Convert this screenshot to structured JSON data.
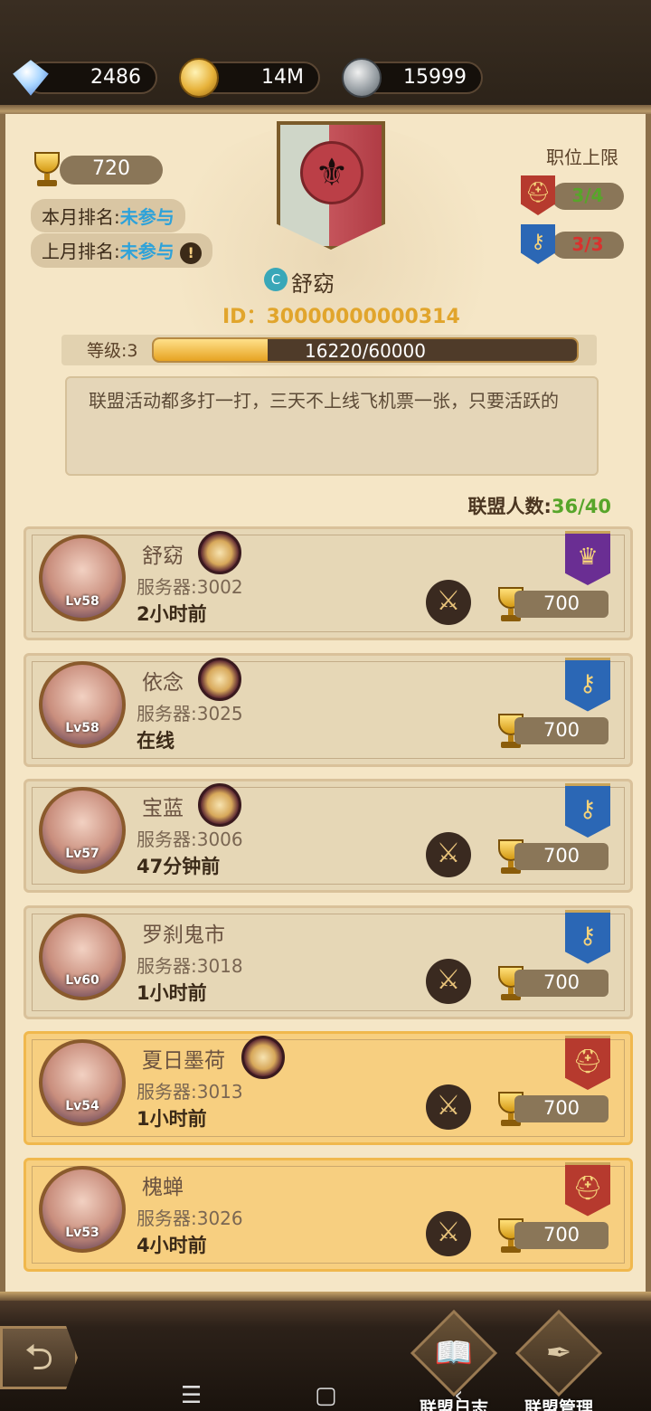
{
  "resources": {
    "diamonds": "2486",
    "gold": "14M",
    "silver": "15999"
  },
  "guild": {
    "trophy_points": "720",
    "this_month_label": "本月排名:",
    "this_month_value": "未参与",
    "last_month_label": "上月排名:",
    "last_month_value": "未参与",
    "position_limit_label": "职位上限",
    "slot_red": "3/4",
    "slot_blue": "3/3",
    "name_badge": "C",
    "name": "舒窈",
    "id_text": "ID：30000000000314",
    "level_label": "等级:3",
    "exp_text": "16220/60000",
    "exp_progress": 0.27,
    "notice": "联盟活动都多打一打，三天不上线飞机票一张，只要活跃的",
    "member_count_label": "联盟人数:",
    "member_count_value": "36/40"
  },
  "members": [
    {
      "name": "舒窈",
      "level": "Lv58",
      "server": "服务器:3002",
      "status": "2小时前",
      "score": "700",
      "role": "purple",
      "role_icon": "crown-icon",
      "badge": true,
      "swords": true,
      "highlight": false
    },
    {
      "name": "依念",
      "level": "Lv58",
      "server": "服务器:3025",
      "status": "在线",
      "score": "700",
      "role": "blue",
      "role_icon": "key-icon",
      "badge": true,
      "swords": false,
      "highlight": false
    },
    {
      "name": "宝蓝",
      "level": "Lv57",
      "server": "服务器:3006",
      "status": "47分钟前",
      "score": "700",
      "role": "blue",
      "role_icon": "key-icon",
      "badge": true,
      "swords": true,
      "highlight": false
    },
    {
      "name": "罗刹鬼市",
      "level": "Lv60",
      "server": "服务器:3018",
      "status": "1小时前",
      "score": "700",
      "role": "blue",
      "role_icon": "key-icon",
      "badge": false,
      "swords": true,
      "highlight": false
    },
    {
      "name": "夏日墨荷",
      "level": "Lv54",
      "server": "服务器:3013",
      "status": "1小时前",
      "score": "700",
      "role": "red",
      "role_icon": "helmet-icon",
      "badge": true,
      "swords": true,
      "highlight": true
    },
    {
      "name": "槐蝉",
      "level": "Lv53",
      "server": "服务器:3026",
      "status": "4小时前",
      "score": "700",
      "role": "red",
      "role_icon": "helmet-icon",
      "badge": false,
      "swords": true,
      "highlight": true
    }
  ],
  "bottom": {
    "guild_log": "联盟日志",
    "guild_manage": "联盟管理"
  },
  "colors": {
    "accent_gold": "#e1a52c",
    "online_green": "#57a52a",
    "highlight_blue": "#2ea2d9"
  }
}
